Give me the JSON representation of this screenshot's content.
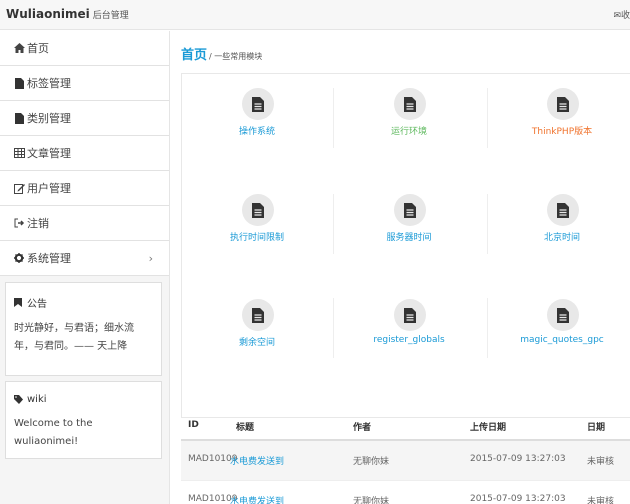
{
  "header": {
    "brand": "Wuliaonimei",
    "brand_sub": "后台管理",
    "right_text": "✉收"
  },
  "sidebar": {
    "items": [
      {
        "label": "首页",
        "icon": "home-icon"
      },
      {
        "label": "标签管理",
        "icon": "file-icon"
      },
      {
        "label": "类别管理",
        "icon": "file-icon"
      },
      {
        "label": "文章管理",
        "icon": "table-icon"
      },
      {
        "label": "用户管理",
        "icon": "edit-icon"
      },
      {
        "label": "注销",
        "icon": "logout-icon"
      },
      {
        "label": "系统管理",
        "icon": "gear-icon",
        "arrow": "›"
      }
    ],
    "notice": {
      "title": "公告",
      "body": "时光静好，与君语；细水流年，与君同。—— 天上降"
    },
    "wiki": {
      "title": "wiki",
      "body": "Welcome to the wuliaonimei!"
    }
  },
  "main": {
    "breadcrumb_home": "首页",
    "breadcrumb_desc": "/ 一些常用模块",
    "modules": [
      {
        "label": "操作系统",
        "color": "#1a9ad6"
      },
      {
        "label": "运行环境",
        "color": "#5cb85c"
      },
      {
        "label": "ThinkPHP版本",
        "color": "#f0732d"
      },
      {
        "label": "执行时间限制",
        "color": "#1a9ad6"
      },
      {
        "label": "服务器时间",
        "color": "#1a9ad6"
      },
      {
        "label": "北京时间",
        "color": "#1a9ad6"
      },
      {
        "label": "剩余空间",
        "color": "#1a9ad6"
      },
      {
        "label": "register_globals",
        "color": "#1a9ad6"
      },
      {
        "label": "magic_quotes_gpc",
        "color": "#1a9ad6"
      }
    ],
    "table": {
      "headers": [
        "ID",
        "标题",
        "作者",
        "上传日期",
        "日期"
      ],
      "rows": [
        {
          "id": "MAD10109",
          "title": "水电费发送到",
          "author": "无聊你妹",
          "date": "2015-07-09 13:27:03",
          "status": "未审核"
        },
        {
          "id": "MAD10109",
          "title": "水电费发送到",
          "author": "无聊你妹",
          "date": "2015-07-09 13:27:03",
          "status": "未审核"
        }
      ]
    }
  }
}
